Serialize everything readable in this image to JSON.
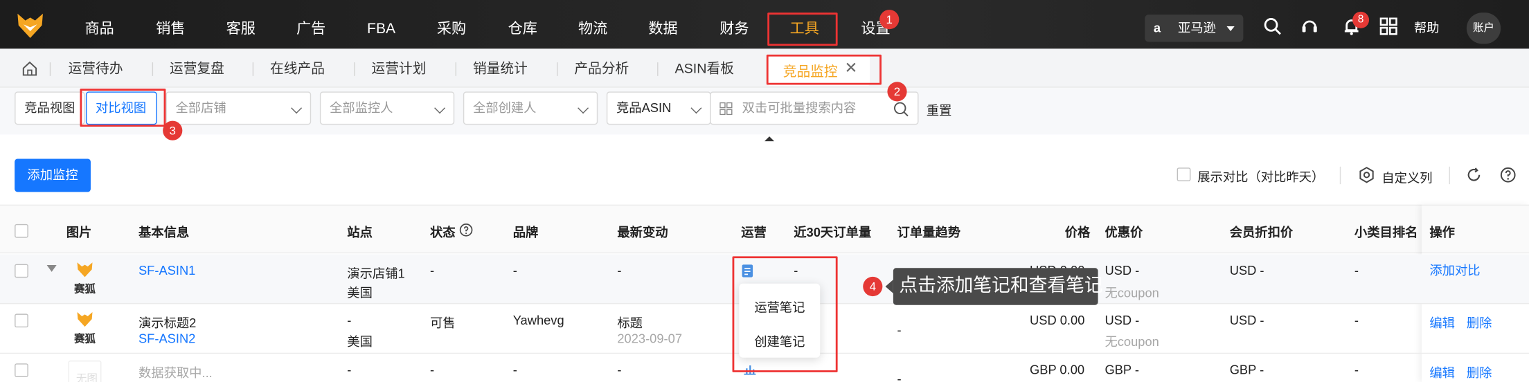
{
  "nav": {
    "items": [
      "商品",
      "销售",
      "客服",
      "广告",
      "FBA",
      "采购",
      "仓库",
      "物流",
      "数据",
      "财务",
      "工具",
      "设置"
    ],
    "active": "工具",
    "marketplace": "亚马逊",
    "notification_count": "8",
    "help": "帮助",
    "account": "账户"
  },
  "tabs": {
    "items": [
      "运营待办",
      "运营复盘",
      "在线产品",
      "运营计划",
      "销量统计",
      "产品分析",
      "ASIN看板"
    ],
    "active": "竞品监控"
  },
  "filters": {
    "view_buttons": [
      "竞品视图",
      "对比视图"
    ],
    "active_view": "对比视图",
    "store_placeholder": "全部店铺",
    "monitor_placeholder": "全部监控人",
    "creator_placeholder": "全部创建人",
    "search_type": "竞品ASIN",
    "search_placeholder": "双击可批量搜索内容",
    "reset": "重置"
  },
  "toolbar": {
    "add_monitor": "添加监控",
    "show_compare": "展示对比（对比昨天）",
    "custom_columns": "自定义列"
  },
  "table": {
    "headers": [
      "图片",
      "基本信息",
      "站点",
      "状态",
      "品牌",
      "最新变动",
      "运营",
      "近30天订单量",
      "订单量趋势",
      "价格",
      "优惠价",
      "会员折扣价",
      "小类目排名",
      "操作"
    ],
    "rows": [
      {
        "thumb": "赛狐",
        "asin": "SF-ASIN1",
        "site_store": "演示店铺1",
        "site_country": "美国",
        "status": "-",
        "brand": "-",
        "change": "-",
        "orders": "-",
        "price": "USD 0.00",
        "promo": "USD -",
        "promo_note": "无coupon",
        "member": "USD -",
        "rank": "-",
        "action": "添加对比"
      },
      {
        "thumb": "赛狐",
        "title": "演示标题2",
        "asin": "SF-ASIN2",
        "site_store": "-",
        "site_country": "美国",
        "status": "可售",
        "brand": "Yawhevg",
        "change": "标题",
        "change_date": "2023-09-07",
        "trend": "-",
        "price": "USD 0.00",
        "promo": "USD -",
        "promo_note": "无coupon",
        "member": "USD -",
        "rank": "-",
        "actions": [
          "编辑",
          "删除"
        ]
      },
      {
        "thumb": "无图",
        "title": "数据获取中...",
        "site_store": "-",
        "status": "-",
        "brand": "-",
        "change": "-",
        "trend": "-",
        "price": "GBP 0.00",
        "promo": "GBP -",
        "member": "GBP -",
        "rank": "-",
        "actions": [
          "编辑",
          "删除"
        ]
      }
    ]
  },
  "popup": {
    "items": [
      "运营笔记",
      "创建笔记"
    ]
  },
  "annotations": {
    "markers": [
      "1",
      "2",
      "3",
      "4"
    ],
    "tooltip": "点击添加笔记和查看笔记"
  },
  "colors": {
    "accent": "#1677ff",
    "highlight": "#e33333",
    "topbar": "#1e1e1e",
    "active_nav": "#f5a623"
  }
}
